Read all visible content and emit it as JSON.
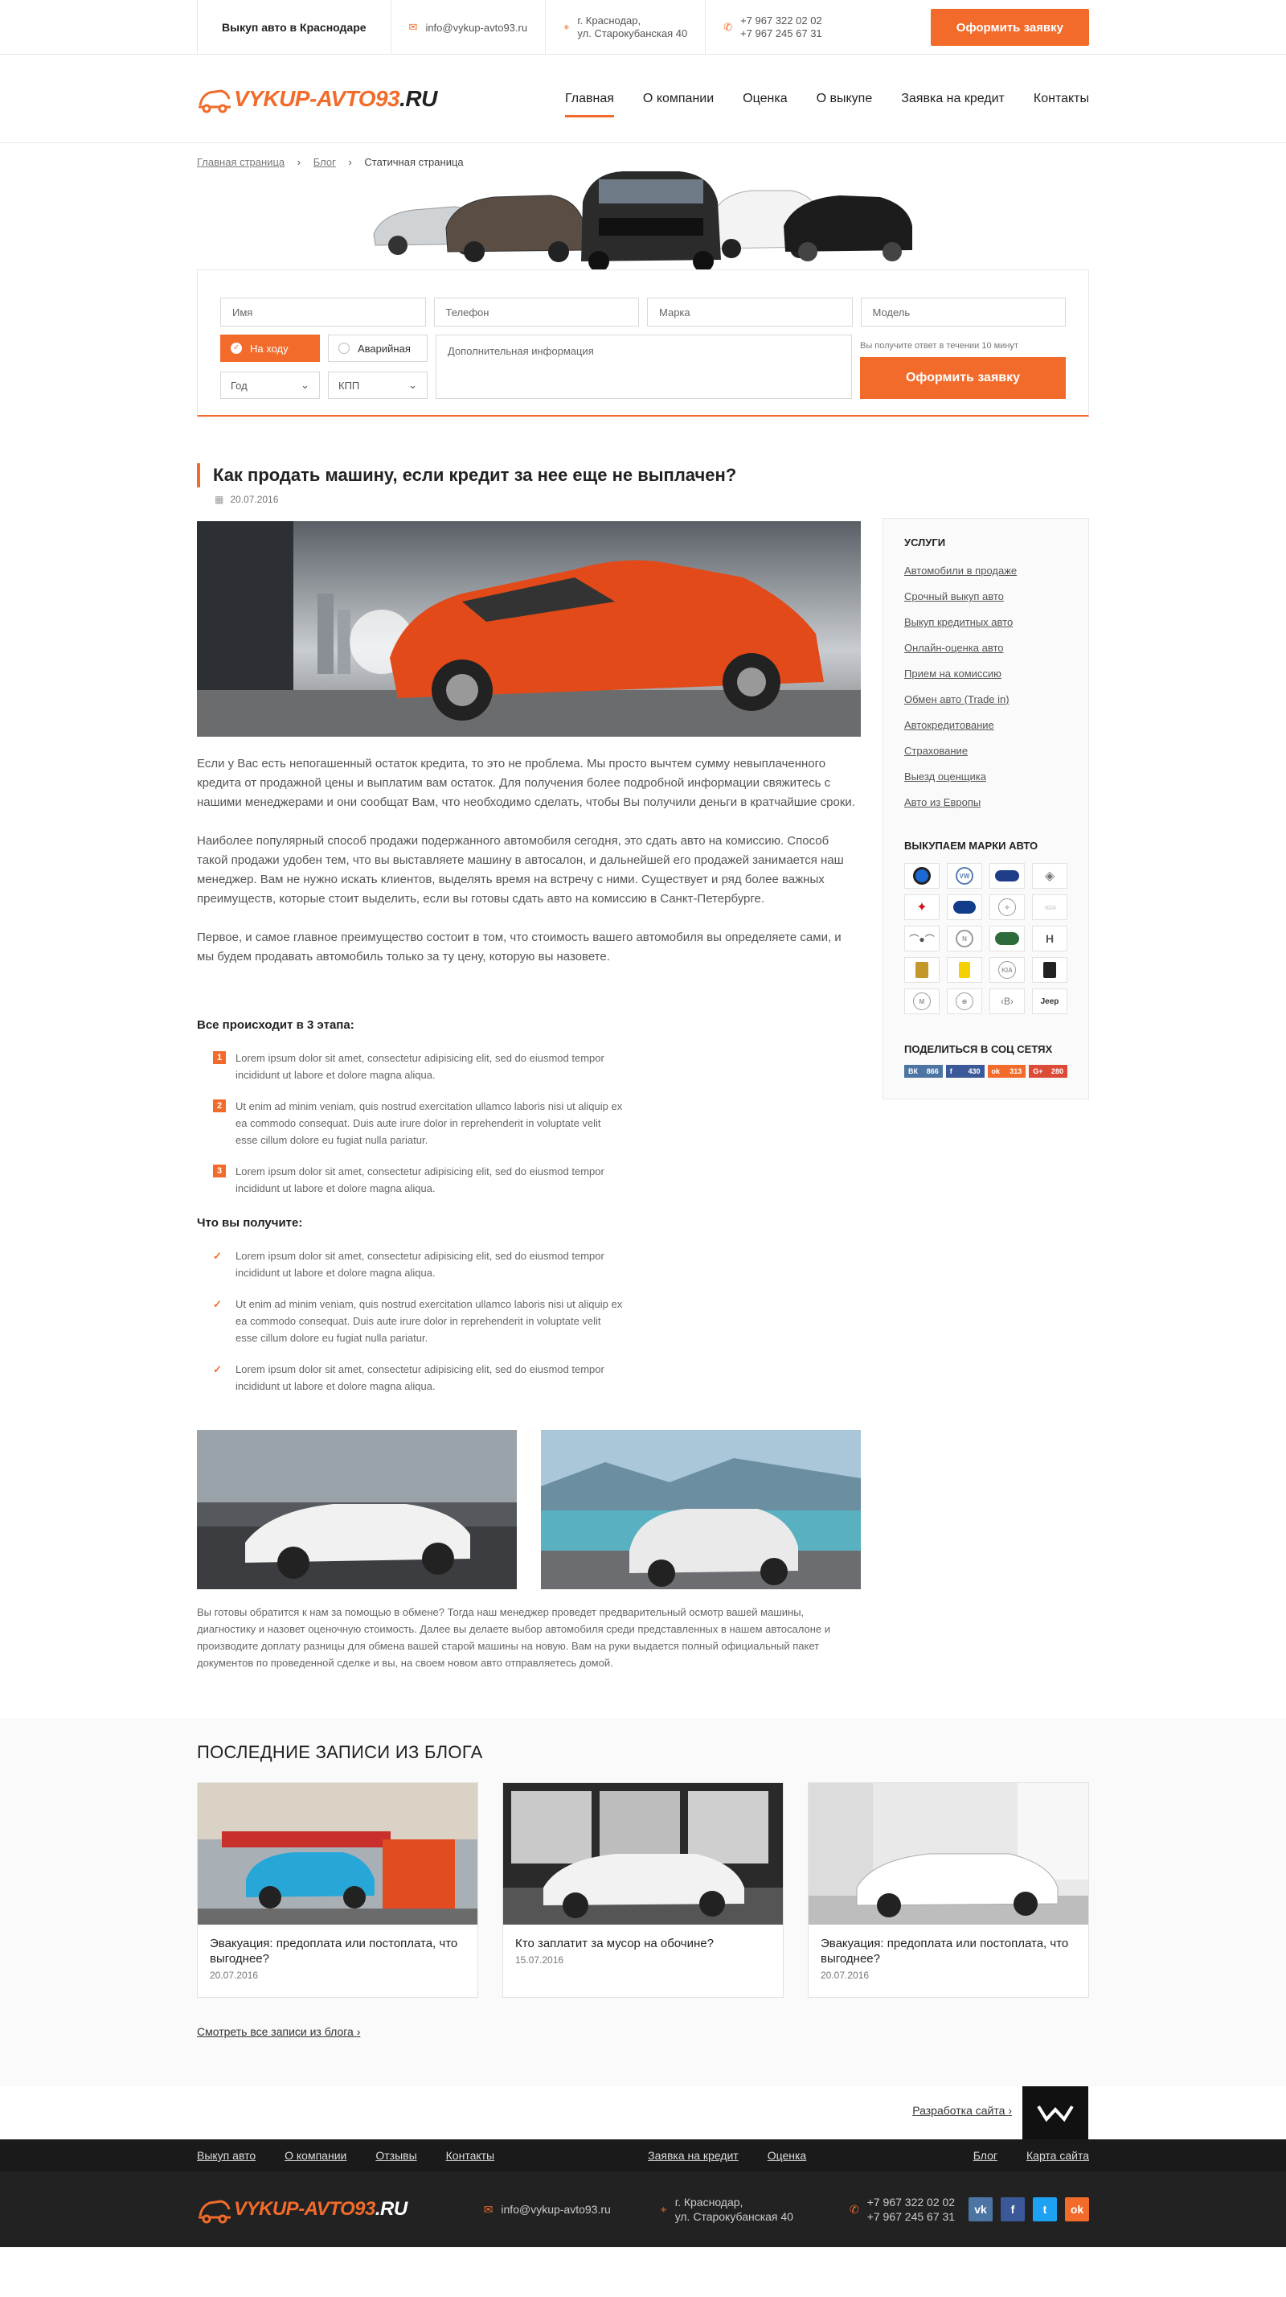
{
  "topbar": {
    "city": "Выкуп авто в Краснодаре",
    "email": "info@vykup-avto93.ru",
    "address_line1": "г. Краснодар,",
    "address_line2": "ул. Старокубанская 40",
    "phone1": "+7 967 322 02 02",
    "phone2": "+7 967 245 67 31",
    "order_btn": "Оформить заявку"
  },
  "logo": {
    "main": "VYKUP-AVTO93",
    "domain": ".RU"
  },
  "nav": [
    "Главная",
    "О компании",
    "Оценка",
    "О выкупе",
    "Заявка на кредит",
    "Контакты"
  ],
  "breadcrumb": {
    "home": "Главная страница",
    "blog": "Блог",
    "current": "Статичная страница"
  },
  "form": {
    "name": "Имя",
    "phone": "Телефон",
    "brand": "Марка",
    "model": "Модель",
    "radio_on": "На ходу",
    "radio_off": "Аварийная",
    "year": "Год",
    "gearbox": "КПП",
    "info": "Дополнительная информация",
    "hint": "Вы получите ответ в течении 10 минут",
    "submit": "Оформить заявку"
  },
  "article": {
    "title": "Как продать машину, если кредит за нее еще не выплачен?",
    "date": "20.07.2016",
    "p1": "Если у Вас есть непогашенный остаток кредита, то это не проблема. Мы просто вычтем сумму невыплаченного кредита от продажной цены и выплатим вам остаток. Для получения более подробной информации свяжитесь с нашими менеджерами и они сообщат Вам, что необходимо сделать, чтобы Вы получили деньги в кратчайшие сроки.",
    "p2": "Наиболее популярный способ продажи подержанного автомобиля сегодня, это сдать авто на комиссию. Способ такой продажи удобен тем, что вы выставляете машину в автосалон, и дальнейшей его продажей занимается наш менеджер. Вам не нужно искать клиентов, выделять время на встречу с ними. Существует и ряд более важных преимуществ, которые стоит выделить, если вы готовы сдать авто на комиссию в Санкт-Петербурге.",
    "p3": "Первое, и самое главное преимущество состоит в том, что стоимость вашего автомобиля вы определяете сами, и мы будем продавать автомобиль только за ту цену, которую вы назовете.",
    "steps_title": "Все происходит в 3 этапа:",
    "steps": [
      {
        "n": "1",
        "t": "Lorem ipsum dolor sit amet, consectetur adipisicing elit, sed do eiusmod tempor incididunt ut labore et dolore magna aliqua."
      },
      {
        "n": "2",
        "t": "Ut enim ad minim veniam, quis nostrud exercitation ullamco laboris nisi ut aliquip ex ea commodo consequat. Duis aute irure dolor in reprehenderit in voluptate velit esse cillum dolore eu fugiat nulla pariatur."
      },
      {
        "n": "3",
        "t": "Lorem ipsum dolor sit amet, consectetur adipisicing elit, sed do eiusmod tempor incididunt ut labore et dolore magna aliqua."
      }
    ],
    "gets_title": "Что вы получите:",
    "gets": [
      "Lorem ipsum dolor sit amet, consectetur adipisicing elit, sed do eiusmod tempor incididunt ut labore et dolore magna aliqua.",
      "Ut enim ad minim veniam, quis nostrud exercitation ullamco laboris nisi ut aliquip ex ea commodo consequat. Duis aute irure dolor in reprehenderit in voluptate velit esse cillum dolore eu fugiat nulla pariatur.",
      "Lorem ipsum dolor sit amet, consectetur adipisicing elit, sed do eiusmod tempor incididunt ut labore et dolore magna aliqua."
    ],
    "caption": "Вы готовы обратится к нам за помощью в обмене? Тогда наш менеджер проведет предварительный осмотр вашей машины, диагностику и назовет оценочную стоимость. Далее вы делаете выбор автомобиля среди представленных в нашем автосалоне и производите доплату разницы для обмена вашей старой машины на новую. Вам на руки выдается полный официальный пакет документов по проведенной сделке и вы, на своем новом авто отправляетесь домой."
  },
  "aside": {
    "services_title": "УСЛУГИ",
    "services": [
      "Автомобили в продаже",
      "Срочный выкуп авто",
      "Выкуп кредитных авто",
      "Онлайн-оценка авто",
      "Прием на комиссию",
      "Обмен авто (Trade in)",
      "Автокредитование",
      "Страхование",
      "Выезд оценщика",
      "Авто из Европы"
    ],
    "brands_title": "ВЫКУПАЕМ МАРКИ  АВТО",
    "share_title": "ПОДЕЛИТЬСЯ В СОЦ СЕТЯХ",
    "share": [
      {
        "icon": "vk-icon",
        "label": "ВК",
        "count": "866",
        "color": "#4c75a3"
      },
      {
        "icon": "facebook-icon",
        "label": "f",
        "count": "430",
        "color": "#3b5998"
      },
      {
        "icon": "odnoklassniki-icon",
        "label": "ok",
        "count": "313",
        "color": "#f26b2b"
      },
      {
        "icon": "googleplus-icon",
        "label": "G+",
        "count": "280",
        "color": "#dc4a38"
      }
    ]
  },
  "blog": {
    "title": "ПОСЛЕДНИЕ ЗАПИСИ ИЗ БЛОГА",
    "posts": [
      {
        "title": "Эвакуация: предоплата или постоплата, что выгоднее?",
        "date": "20.07.2016"
      },
      {
        "title": "Кто заплатит за мусор на обочине?",
        "date": "15.07.2016"
      },
      {
        "title": "Эвакуация: предоплата или постоплата, что выгоднее?",
        "date": "20.07.2016"
      }
    ],
    "all_link": "Смотреть все записи из блога"
  },
  "dev_link": "Разработка сайта",
  "footer": {
    "nav_left": [
      "Выкуп авто",
      "О компании",
      "Отзывы",
      "Контакты"
    ],
    "nav_mid": [
      "Заявка на кредит",
      "Оценка"
    ],
    "nav_right": [
      "Блог",
      "Карта сайта"
    ],
    "email": "info@vykup-avto93.ru",
    "address_line1": "г. Краснодар,",
    "address_line2": "ул. Старокубанская 40",
    "phone1": "+7 967 322 02 02",
    "phone2": "+7 967 245 67 31",
    "social": [
      "vk-icon",
      "facebook-icon",
      "twitter-icon",
      "odnoklassniki-icon"
    ]
  },
  "colors": {
    "accent": "#f26b2b",
    "dark": "#222222"
  }
}
